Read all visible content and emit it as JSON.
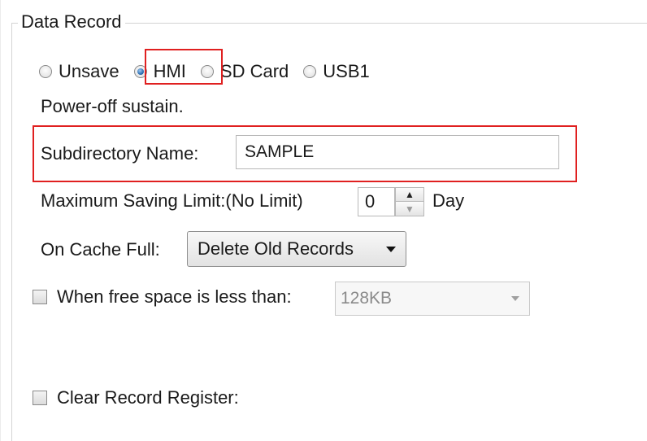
{
  "group": {
    "title": "Data Record"
  },
  "storage": {
    "options": [
      {
        "label": "Unsave",
        "selected": false
      },
      {
        "label": "HMI",
        "selected": true
      },
      {
        "label": "SD Card",
        "selected": false
      },
      {
        "label": "USB1",
        "selected": false
      }
    ],
    "note": "Power-off sustain."
  },
  "subdirectory": {
    "label": "Subdirectory Name:",
    "value": "SAMPLE"
  },
  "max_saving": {
    "label": "Maximum Saving Limit:(No Limit)",
    "value": "0",
    "unit": "Day"
  },
  "cache_full": {
    "label": "On Cache Full:",
    "value": "Delete Old Records"
  },
  "free_space": {
    "label": "When free space is less than:",
    "value": "128KB",
    "checked": false
  },
  "clear_register": {
    "label": "Clear Record Register:",
    "checked": false
  },
  "colors": {
    "highlight": "#e02020",
    "radio_selected": "#2d6fb3"
  },
  "icons": {
    "spin_up": "arrow-up-icon",
    "spin_down": "arrow-down-icon",
    "dropdown": "chevron-down-icon"
  }
}
